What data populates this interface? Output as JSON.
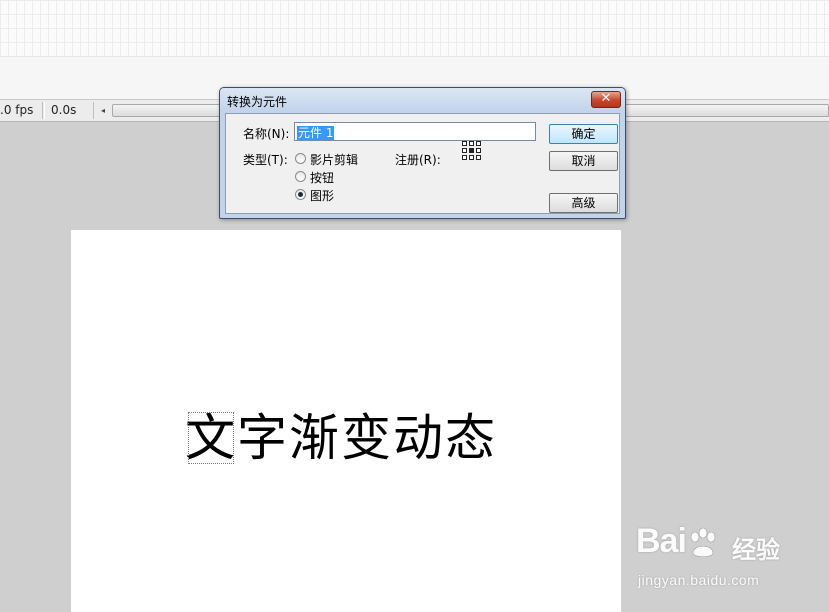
{
  "timeline": {
    "fps": ".0 fps",
    "time": "0.0s",
    "scroll_left_glyph": "◂"
  },
  "stage": {
    "text_selected": "文",
    "text_rest": "字渐变动态"
  },
  "dialog": {
    "title": "转换为元件",
    "close_glyph": "✕",
    "name_label": "名称(N):",
    "name_value": "元件 1",
    "type_label": "类型(T):",
    "types": [
      {
        "label": "影片剪辑",
        "checked": false
      },
      {
        "label": "按钮",
        "checked": false
      },
      {
        "label": "图形",
        "checked": true
      }
    ],
    "registration_label": "注册(R):",
    "ok_label": "确定",
    "cancel_label": "取消",
    "advanced_label": "高级"
  },
  "watermark": {
    "logo_text_1": "Bai",
    "logo_text_2": "经验",
    "url": "jingyan.baidu.com",
    "icon": "baidu-paw-icon"
  }
}
